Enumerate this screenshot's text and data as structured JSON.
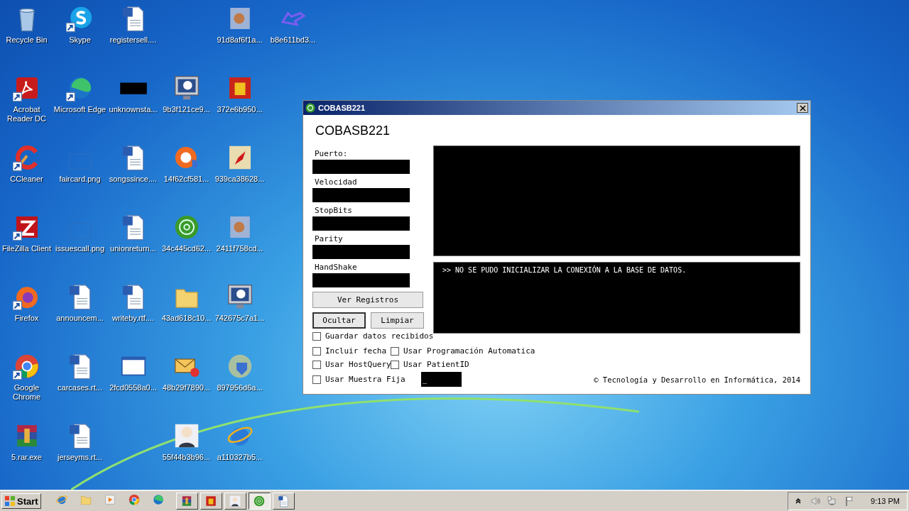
{
  "desktop": {
    "rows": [
      {
        "icons": [
          {
            "kind": "recycle",
            "label": "Recycle Bin",
            "shortcut": false
          },
          {
            "kind": "skype",
            "label": "Skype",
            "shortcut": true
          },
          {
            "kind": "word",
            "label": "registersell....",
            "shortcut": false
          },
          {
            "kind": "blank"
          },
          {
            "kind": "blurred",
            "label": "91d8af6f1a...",
            "shortcut": false
          },
          {
            "kind": "plane",
            "label": "b8e611bd3...",
            "shortcut": false
          }
        ]
      },
      {
        "icons": [
          {
            "kind": "acrobat",
            "label": "Acrobat Reader DC",
            "shortcut": true
          },
          {
            "kind": "edge",
            "label": "Microsoft Edge",
            "shortcut": true
          },
          {
            "kind": "blackbox",
            "label": "unknownsta...",
            "shortcut": false
          },
          {
            "kind": "monitor",
            "label": "9b3f121ce9...",
            "shortcut": false
          },
          {
            "kind": "redbox",
            "label": "372e6b950...",
            "shortcut": false
          }
        ]
      },
      {
        "icons": [
          {
            "kind": "ccleaner",
            "label": "CCleaner",
            "shortcut": true
          },
          {
            "kind": "png",
            "label": "faircard.png",
            "shortcut": false
          },
          {
            "kind": "word",
            "label": "songssince....",
            "shortcut": false
          },
          {
            "kind": "lifebuoy",
            "label": "14f62cf581...",
            "shortcut": false
          },
          {
            "kind": "rocket",
            "label": "939ca38628...",
            "shortcut": false
          }
        ]
      },
      {
        "icons": [
          {
            "kind": "filezilla",
            "label": "FileZilla Client",
            "shortcut": true
          },
          {
            "kind": "png",
            "label": "issuescall.png",
            "shortcut": false
          },
          {
            "kind": "word",
            "label": "unionreturn...",
            "shortcut": false
          },
          {
            "kind": "radar",
            "label": "34c445cd62...",
            "shortcut": false
          },
          {
            "kind": "blurred",
            "label": "2411f758cd...",
            "shortcut": false
          }
        ]
      },
      {
        "icons": [
          {
            "kind": "firefox",
            "label": "Firefox",
            "shortcut": true
          },
          {
            "kind": "word",
            "label": "announcem...",
            "shortcut": false
          },
          {
            "kind": "word",
            "label": "writeby.rtf....",
            "shortcut": false
          },
          {
            "kind": "folder",
            "label": "43ad618c10...",
            "shortcut": false
          },
          {
            "kind": "monitor",
            "label": "742675c7a1...",
            "shortcut": false
          }
        ]
      },
      {
        "icons": [
          {
            "kind": "chrome",
            "label": "Google Chrome",
            "shortcut": true
          },
          {
            "kind": "word",
            "label": "carcases.rt...",
            "shortcut": false
          },
          {
            "kind": "window",
            "label": "2fcd0558a0...",
            "shortcut": false
          },
          {
            "kind": "mail",
            "label": "48b29f7890...",
            "shortcut": false
          },
          {
            "kind": "globe",
            "label": "897956d6a...",
            "shortcut": false
          }
        ]
      },
      {
        "icons": [
          {
            "kind": "rar",
            "label": "5.rar.exe",
            "shortcut": false
          },
          {
            "kind": "word",
            "label": "jerseyms.rt...",
            "shortcut": false
          },
          {
            "kind": "blank"
          },
          {
            "kind": "figure",
            "label": "55f44b3b96...",
            "shortcut": false
          },
          {
            "kind": "ie",
            "label": "a110327b5...",
            "shortcut": false
          }
        ]
      }
    ]
  },
  "window": {
    "title": "COBASB221",
    "heading": "COBASB221",
    "fields": [
      {
        "label": "Puerto:"
      },
      {
        "label": "Velocidad"
      },
      {
        "label": "StopBits"
      },
      {
        "label": "Parity"
      },
      {
        "label": "HandShake"
      }
    ],
    "buttons": [
      {
        "label": "Ver Registros",
        "default": false
      },
      {
        "label": "Ocultar",
        "default": true
      },
      {
        "label": "Limpiar",
        "default": false
      }
    ],
    "log": ">> NO SE PUDO INICIALIZAR LA CONEXIÓN A LA BASE DE DATOS.",
    "checkboxes": [
      {
        "label": "Guardar datos recibidos",
        "checked": false
      },
      {
        "label": "Incluir fecha",
        "checked": false
      },
      {
        "label": "Usar Programación Automatica",
        "checked": false
      },
      {
        "label": "Usar HostQuery",
        "checked": false
      },
      {
        "label": "Usar PatientID",
        "checked": false
      },
      {
        "label": "Usar Muestra Fija",
        "checked": false
      }
    ],
    "sample_field": {
      "value": "_"
    },
    "footer": "© Tecnología y Desarrollo en Informática, 2014"
  },
  "taskbar": {
    "start": "Start",
    "quick_launch": [
      {
        "kind": "ie"
      },
      {
        "kind": "folder"
      },
      {
        "kind": "media"
      },
      {
        "kind": "chrome"
      },
      {
        "kind": "edge"
      }
    ],
    "tasks": [
      {
        "kind": "rar",
        "selected": false
      },
      {
        "kind": "redbox",
        "selected": false
      },
      {
        "kind": "figure",
        "selected": false
      },
      {
        "kind": "radar",
        "selected": true
      },
      {
        "kind": "word",
        "selected": false
      }
    ],
    "tray": [
      {
        "kind": "chevron"
      },
      {
        "kind": "speaker"
      },
      {
        "kind": "network"
      },
      {
        "kind": "flag"
      }
    ],
    "clock": "9:13 PM"
  }
}
